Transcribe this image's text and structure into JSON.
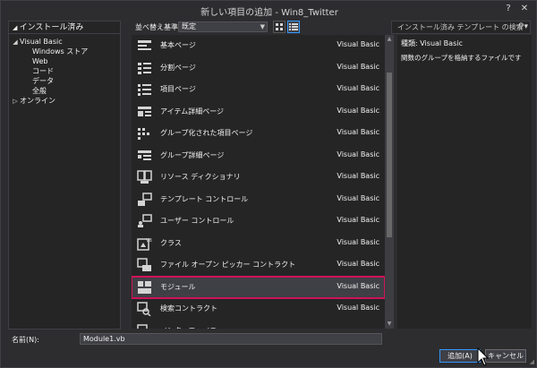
{
  "window": {
    "title": "新しい項目の追加 - Win8_Twitter",
    "help": "?",
    "close": "✕"
  },
  "left_panel": {
    "header": "インストール済み",
    "tree": [
      {
        "label": "Visual Basic",
        "expanded": true,
        "indent": 0,
        "arrow": "◢"
      },
      {
        "label": "Windows ストア",
        "indent": 1,
        "arrow": ""
      },
      {
        "label": "Web",
        "indent": 1,
        "arrow": ""
      },
      {
        "label": "コード",
        "indent": 1,
        "arrow": ""
      },
      {
        "label": "データ",
        "indent": 1,
        "arrow": ""
      },
      {
        "label": "全般",
        "indent": 1,
        "arrow": ""
      },
      {
        "label": "オンライン",
        "expanded": false,
        "indent": 0,
        "arrow": "▷"
      }
    ]
  },
  "toolbar": {
    "sort_label": "並べ替え基準:",
    "sort_value": "既定"
  },
  "search": {
    "placeholder": "インストール済み テンプレート の検索 (Ctrl"
  },
  "templates": [
    {
      "name": "基本ページ",
      "lang": "Visual Basic",
      "icon": "basic-page-icon"
    },
    {
      "name": "分割ページ",
      "lang": "Visual Basic",
      "icon": "split-page-icon"
    },
    {
      "name": "項目ページ",
      "lang": "Visual Basic",
      "icon": "items-page-icon"
    },
    {
      "name": "アイテム詳細ページ",
      "lang": "Visual Basic",
      "icon": "item-detail-page-icon"
    },
    {
      "name": "グループ化された項目ページ",
      "lang": "Visual Basic",
      "icon": "grouped-items-page-icon"
    },
    {
      "name": "グループ詳細ページ",
      "lang": "Visual Basic",
      "icon": "group-detail-page-icon"
    },
    {
      "name": "リソース ディクショナリ",
      "lang": "Visual Basic",
      "icon": "resource-dictionary-icon"
    },
    {
      "name": "テンプレート コントロール",
      "lang": "Visual Basic",
      "icon": "templated-control-icon"
    },
    {
      "name": "ユーザー コントロール",
      "lang": "Visual Basic",
      "icon": "user-control-icon"
    },
    {
      "name": "クラス",
      "lang": "Visual Basic",
      "icon": "class-icon"
    },
    {
      "name": "ファイル オープン ピッカー コントラクト",
      "lang": "Visual Basic",
      "icon": "file-picker-contract-icon"
    },
    {
      "name": "モジュール",
      "lang": "Visual Basic",
      "icon": "module-icon",
      "selected": true
    },
    {
      "name": "検索コントラクト",
      "lang": "Visual Basic",
      "icon": "search-contract-icon"
    },
    {
      "name": "インターフェイス",
      "lang": "",
      "icon": "interface-icon"
    }
  ],
  "details": {
    "type_label": "種類:",
    "type_value": "Visual Basic",
    "description": "関数のグループを格納するファイルです"
  },
  "name_field": {
    "label": "名前(N):",
    "value": "Module1.vb"
  },
  "buttons": {
    "add": "追加(A)",
    "cancel": "キャンセル"
  },
  "colors": {
    "background": "#2d2d30",
    "panel": "#252526",
    "selection_outline": "#d0125a",
    "accent": "#3399ff"
  }
}
